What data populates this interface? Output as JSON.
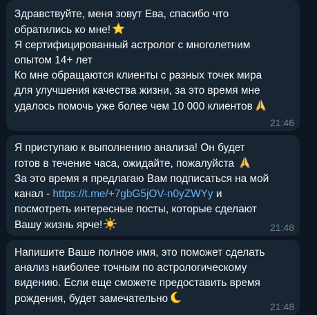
{
  "messages": [
    {
      "lines": [
        "Здравствуйте, меня зовут Ева, спасибо что",
        "обратились ко мне!",
        "Я сертифицированный астролог с многолетним",
        "опытом 14+ лет",
        "Ко мне обращаются клиенты с разных точек мира",
        "для улучшения качества жизни, за это время мне",
        "удалось помочь уже более чем 10 000 клиентов"
      ],
      "time": "21:46"
    },
    {
      "lines": [
        "Я приступаю к выполнению анализа! Он будет",
        "готов в течение часа, ожидайте, пожалуйста",
        "За это время я предлагаю Вам подписаться на мой",
        "канал - ",
        " и",
        "посмотреть интересные посты, которые сделают",
        "Вашу жизнь ярче!"
      ],
      "link": "https://t.me/+7gbG5jOV-n0yZWYy",
      "time": "21:48"
    },
    {
      "lines": [
        "Напишите Ваше полное имя, это поможет сделать",
        "анализ наиболее точным по астрологическому",
        "видению. Если еще сможете предоставить время",
        "рождения, будет замечательно"
      ],
      "time": "21:48"
    }
  ],
  "icons": {
    "star": "star-emoji-icon",
    "pray": "folded-hands-emoji-icon",
    "sun": "sun-emoji-icon",
    "moon": "crescent-moon-emoji-icon"
  },
  "colors": {
    "background": "#0e1621",
    "bubble": "#182533",
    "text": "#f5f5f5",
    "link": "#6ab3f3",
    "time": "#6d7f8f"
  }
}
